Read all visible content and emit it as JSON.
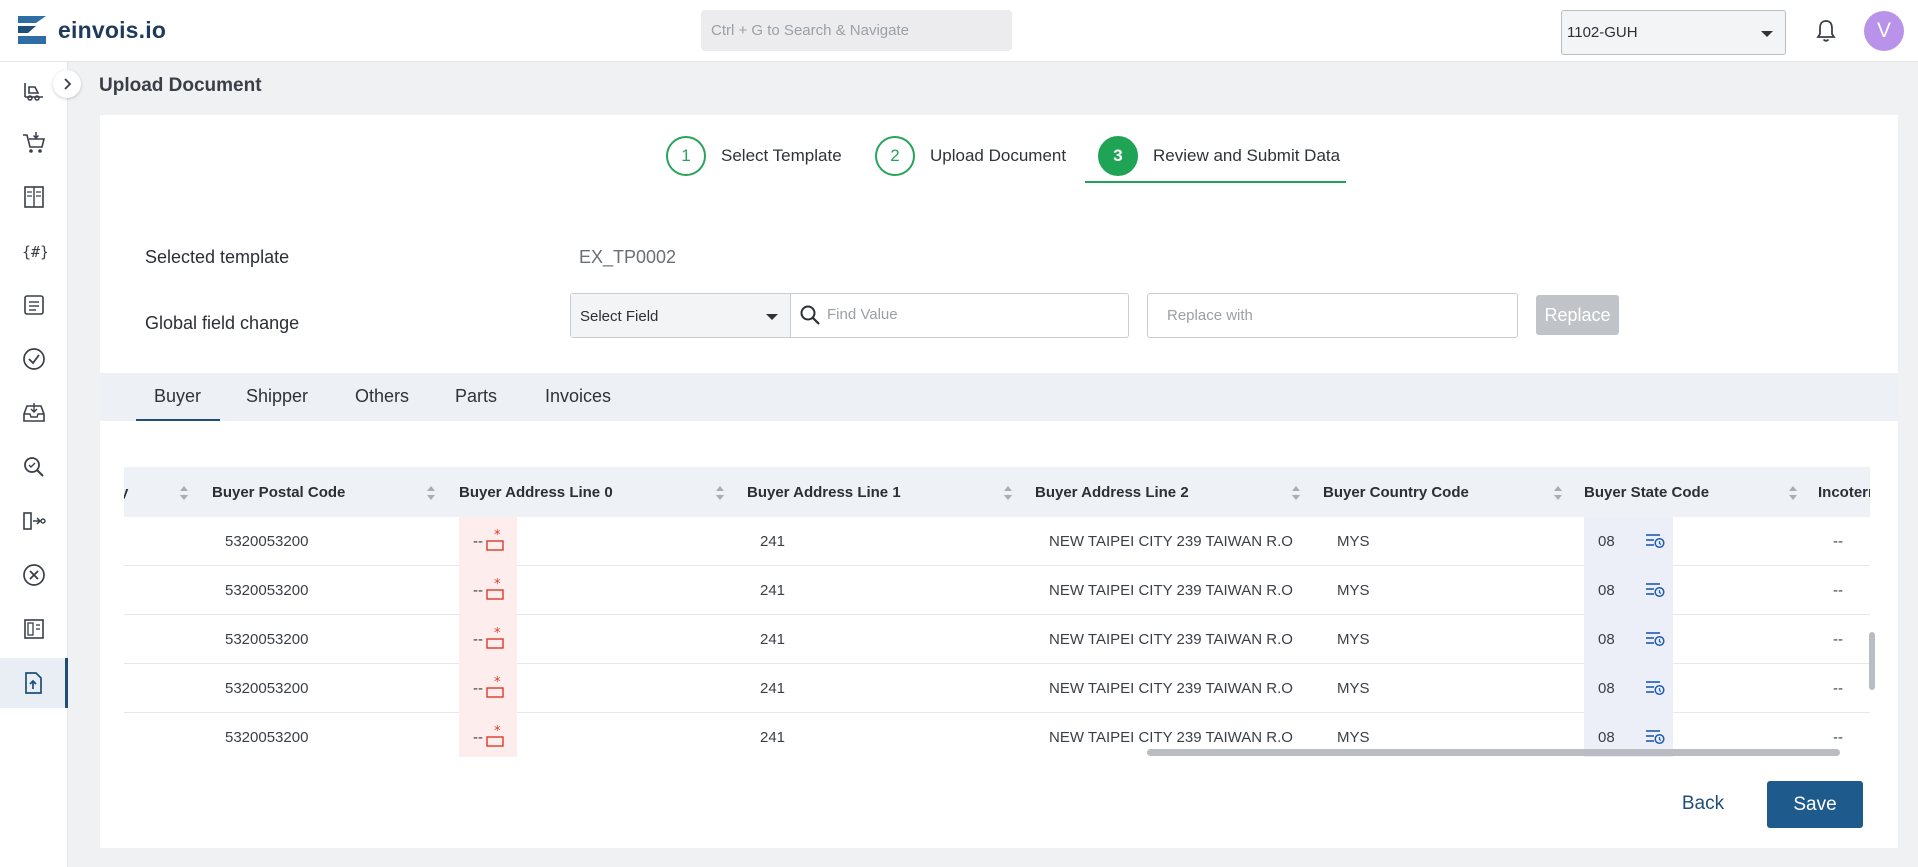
{
  "app": {
    "name": "einvois.io",
    "search_placeholder": "Ctrl + G to Search & Navigate",
    "org": "1102-GUH",
    "user_initial": "V"
  },
  "page": {
    "title": "Upload Document"
  },
  "stepper": [
    {
      "num": "1",
      "label": "Select Template"
    },
    {
      "num": "2",
      "label": "Upload Document"
    },
    {
      "num": "3",
      "label": "Review and Submit Data"
    }
  ],
  "form": {
    "selected_template_label": "Selected template",
    "selected_template_value": "EX_TP0002",
    "global_change_label": "Global field change",
    "select_field": "Select Field",
    "find_placeholder": "Find Value",
    "replace_placeholder": "Replace with",
    "replace_button": "Replace"
  },
  "tabs": [
    "Buyer",
    "Shipper",
    "Others",
    "Parts",
    "Invoices"
  ],
  "table": {
    "columns": [
      "y",
      "Buyer Postal Code",
      "Buyer Address Line 0",
      "Buyer Address Line 1",
      "Buyer Address Line 2",
      "Buyer Country Code",
      "Buyer State Code",
      "Incoterm"
    ],
    "rows": [
      {
        "postal": "5320053200",
        "addr0": "--",
        "addr1": "241",
        "addr2": "NEW TAIPEI CITY 239 TAIWAN R.O",
        "country": "MYS",
        "state": "08",
        "incoterm": "--"
      },
      {
        "postal": "5320053200",
        "addr0": "--",
        "addr1": "241",
        "addr2": "NEW TAIPEI CITY 239 TAIWAN R.O",
        "country": "MYS",
        "state": "08",
        "incoterm": "--"
      },
      {
        "postal": "5320053200",
        "addr0": "--",
        "addr1": "241",
        "addr2": "NEW TAIPEI CITY 239 TAIWAN R.O",
        "country": "MYS",
        "state": "08",
        "incoterm": "--"
      },
      {
        "postal": "5320053200",
        "addr0": "--",
        "addr1": "241",
        "addr2": "NEW TAIPEI CITY 239 TAIWAN R.O",
        "country": "MYS",
        "state": "08",
        "incoterm": "--"
      },
      {
        "postal": "5320053200",
        "addr0": "--",
        "addr1": "241",
        "addr2": "NEW TAIPEI CITY 239 TAIWAN R.O",
        "country": "MYS",
        "state": "08",
        "incoterm": "--"
      }
    ]
  },
  "actions": {
    "back": "Back",
    "save": "Save"
  },
  "colors": {
    "accent": "#1f5a8c",
    "step_done": "#1fa355",
    "error_bg": "#fdeeed",
    "error_icon": "#d93a2b"
  }
}
